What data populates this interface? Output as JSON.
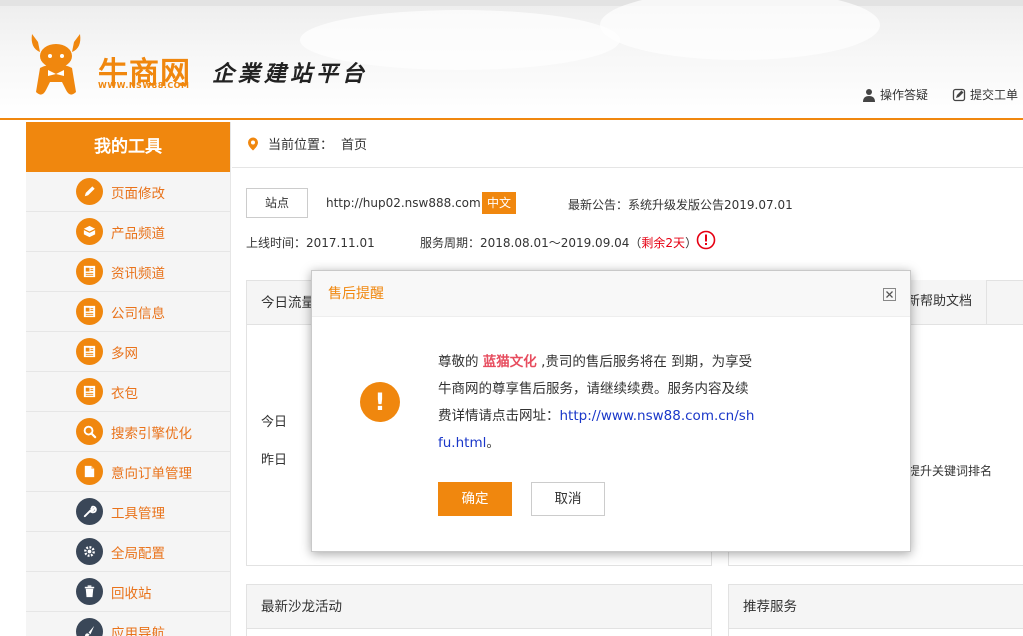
{
  "header": {
    "brand_name": "牛商网",
    "brand_url": "WWW.NSW88.COM",
    "slogan": "企業建站平台",
    "links": [
      {
        "label": "操作答疑",
        "icon": "user-icon"
      },
      {
        "label": "提交工单",
        "icon": "edit-icon"
      }
    ]
  },
  "sidebar": {
    "title": "我的工具",
    "items": [
      {
        "label": "页面修改",
        "icon": "pencil-icon"
      },
      {
        "label": "产品频道",
        "icon": "box-icon"
      },
      {
        "label": "资讯频道",
        "icon": "news-icon"
      },
      {
        "label": "公司信息",
        "icon": "news-icon"
      },
      {
        "label": "多网",
        "icon": "news-icon"
      },
      {
        "label": "衣包",
        "icon": "news-icon"
      },
      {
        "label": "搜索引擎优化",
        "icon": "search-icon"
      },
      {
        "label": "意向订单管理",
        "icon": "document-icon"
      },
      {
        "label": "工具管理",
        "icon": "wrench-icon"
      },
      {
        "label": "全局配置",
        "icon": "gear-icon"
      },
      {
        "label": "回收站",
        "icon": "trash-icon"
      },
      {
        "label": "应用导航",
        "icon": "brush-icon"
      }
    ]
  },
  "main": {
    "breadcrumb_label": "当前位置：",
    "breadcrumb_page": "首页",
    "site_button": "站点",
    "site_url": "http://hup02.nsw888.com",
    "lang_badge": "中文",
    "notice": "最新公告：系统升级发版公告2019.07.01",
    "online_time": "上线时间：2017.11.01",
    "service_period": "服务周期：2018.08.01～2019.09.04（",
    "service_remain": "剩余2天",
    "service_close": "）",
    "traffic_panel": {
      "title": "今日流量",
      "today": "今日",
      "yesterday": "昨日"
    },
    "help_tab": "新帮助文档",
    "keyword_text": "提升关键词排名",
    "salon_panel": {
      "title": "最新沙龙活动"
    },
    "recommend_panel": {
      "title": "推荐服务"
    }
  },
  "modal": {
    "title": "售后提醒",
    "text_before": "尊敬的 ",
    "company": "蓝猫文化",
    "text_middle": " ,贵司的售后服务将在 到期，为享受牛商网的尊享售后服务，请继续续费。服务内容及续费详情请点击网址：",
    "link": "http://www.nsw88.com.cn/shfu.html",
    "text_after": "。",
    "ok_label": "确定",
    "cancel_label": "取消"
  },
  "colors": {
    "accent": "#f0870e",
    "warning": "#e60012",
    "link": "#1a37c9"
  }
}
